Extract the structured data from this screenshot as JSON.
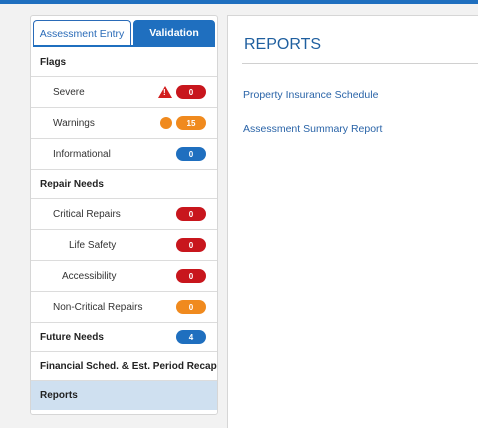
{
  "tabs": {
    "assessment_entry": "Assessment Entry",
    "validation": "Validation"
  },
  "nav": {
    "flags": "Flags",
    "severe": {
      "label": "Severe",
      "count": "0",
      "icon_glyph": "!"
    },
    "warnings": {
      "label": "Warnings",
      "count": "15"
    },
    "informational": {
      "label": "Informational",
      "count": "0"
    },
    "repair_needs": "Repair Needs",
    "critical_repairs": {
      "label": "Critical Repairs",
      "count": "0"
    },
    "life_safety": {
      "label": "Life Safety",
      "count": "0"
    },
    "accessibility": {
      "label": "Accessibility",
      "count": "0"
    },
    "non_critical_repairs": {
      "label": "Non-Critical Repairs",
      "count": "0"
    },
    "future_needs": {
      "label": "Future Needs",
      "count": "4"
    },
    "financial": "Financial Sched. & Est. Period Recap",
    "reports": "Reports"
  },
  "reports_panel": {
    "title": "REPORTS",
    "links": [
      "Property Insurance Schedule",
      "Assessment Summary Report"
    ]
  },
  "colors": {
    "accent": "#1f6fbf",
    "red": "#c8161d",
    "orange": "#f08a1e",
    "blue_badge": "#1f6fbf",
    "selected_bg": "#cfe0f0"
  }
}
